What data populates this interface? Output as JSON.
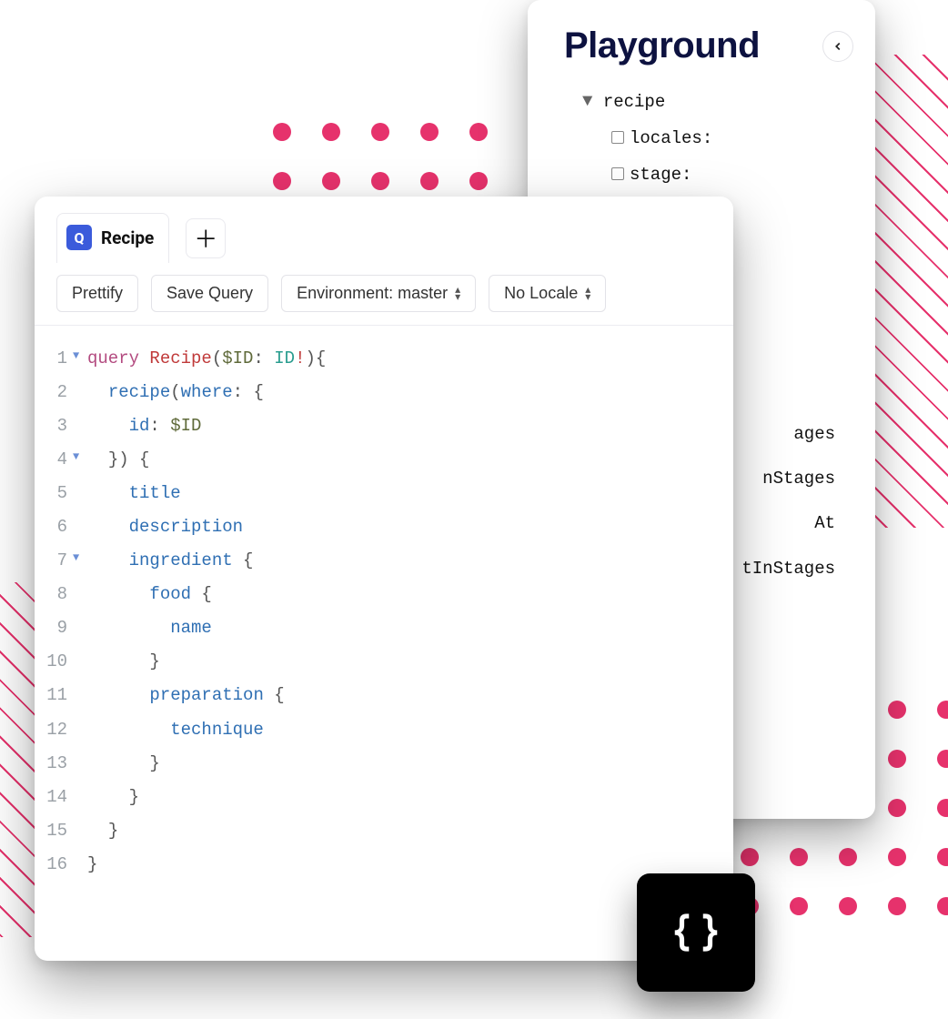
{
  "playground": {
    "title": "Playground",
    "tree_root": "recipe",
    "tree_args": [
      "locales:",
      "stage:"
    ],
    "peek_fragments": [
      "ages",
      "nStages",
      "At",
      "tInStages"
    ]
  },
  "editor": {
    "tab_badge": "Q",
    "tab_label": "Recipe",
    "toolbar": {
      "prettify": "Prettify",
      "save": "Save Query",
      "environment": "Environment: master",
      "locale": "No Locale"
    },
    "code": [
      {
        "n": 1,
        "fold": true,
        "tokens": [
          [
            "keyword",
            "query "
          ],
          [
            "def",
            "Recipe"
          ],
          [
            "punct",
            "("
          ],
          [
            "var",
            "$ID"
          ],
          [
            "punct",
            ": "
          ],
          [
            "type",
            "ID"
          ],
          [
            "bang",
            "!"
          ],
          [
            "punct",
            ")"
          ],
          [
            "punct",
            "{"
          ]
        ]
      },
      {
        "n": 2,
        "fold": false,
        "tokens": [
          [
            "plain",
            "  "
          ],
          [
            "field",
            "recipe"
          ],
          [
            "punct",
            "("
          ],
          [
            "arg",
            "where"
          ],
          [
            "punct",
            ": "
          ],
          [
            "punct",
            "{"
          ]
        ]
      },
      {
        "n": 3,
        "fold": false,
        "tokens": [
          [
            "plain",
            "    "
          ],
          [
            "arg",
            "id"
          ],
          [
            "punct",
            ": "
          ],
          [
            "var",
            "$ID"
          ]
        ]
      },
      {
        "n": 4,
        "fold": true,
        "tokens": [
          [
            "plain",
            "  "
          ],
          [
            "punct",
            "}) {"
          ]
        ]
      },
      {
        "n": 5,
        "fold": false,
        "tokens": [
          [
            "plain",
            "    "
          ],
          [
            "field",
            "title"
          ]
        ]
      },
      {
        "n": 6,
        "fold": false,
        "tokens": [
          [
            "plain",
            "    "
          ],
          [
            "field",
            "description"
          ]
        ]
      },
      {
        "n": 7,
        "fold": true,
        "tokens": [
          [
            "plain",
            "    "
          ],
          [
            "field",
            "ingredient"
          ],
          [
            "punct",
            " {"
          ]
        ]
      },
      {
        "n": 8,
        "fold": false,
        "tokens": [
          [
            "plain",
            "      "
          ],
          [
            "field",
            "food"
          ],
          [
            "punct",
            " {"
          ]
        ]
      },
      {
        "n": 9,
        "fold": false,
        "tokens": [
          [
            "plain",
            "        "
          ],
          [
            "field",
            "name"
          ]
        ]
      },
      {
        "n": 10,
        "fold": false,
        "tokens": [
          [
            "plain",
            "      "
          ],
          [
            "punct",
            "}"
          ]
        ]
      },
      {
        "n": 11,
        "fold": false,
        "tokens": [
          [
            "plain",
            "      "
          ],
          [
            "field",
            "preparation"
          ],
          [
            "punct",
            " {"
          ]
        ]
      },
      {
        "n": 12,
        "fold": false,
        "tokens": [
          [
            "plain",
            "        "
          ],
          [
            "field",
            "technique"
          ]
        ]
      },
      {
        "n": 13,
        "fold": false,
        "tokens": [
          [
            "plain",
            "      "
          ],
          [
            "punct",
            "}"
          ]
        ]
      },
      {
        "n": 14,
        "fold": false,
        "tokens": [
          [
            "plain",
            "    "
          ],
          [
            "punct",
            "}"
          ]
        ]
      },
      {
        "n": 15,
        "fold": false,
        "tokens": [
          [
            "plain",
            "  "
          ],
          [
            "punct",
            "}"
          ]
        ]
      },
      {
        "n": 16,
        "fold": false,
        "tokens": [
          [
            "punct",
            "}"
          ]
        ]
      }
    ]
  }
}
